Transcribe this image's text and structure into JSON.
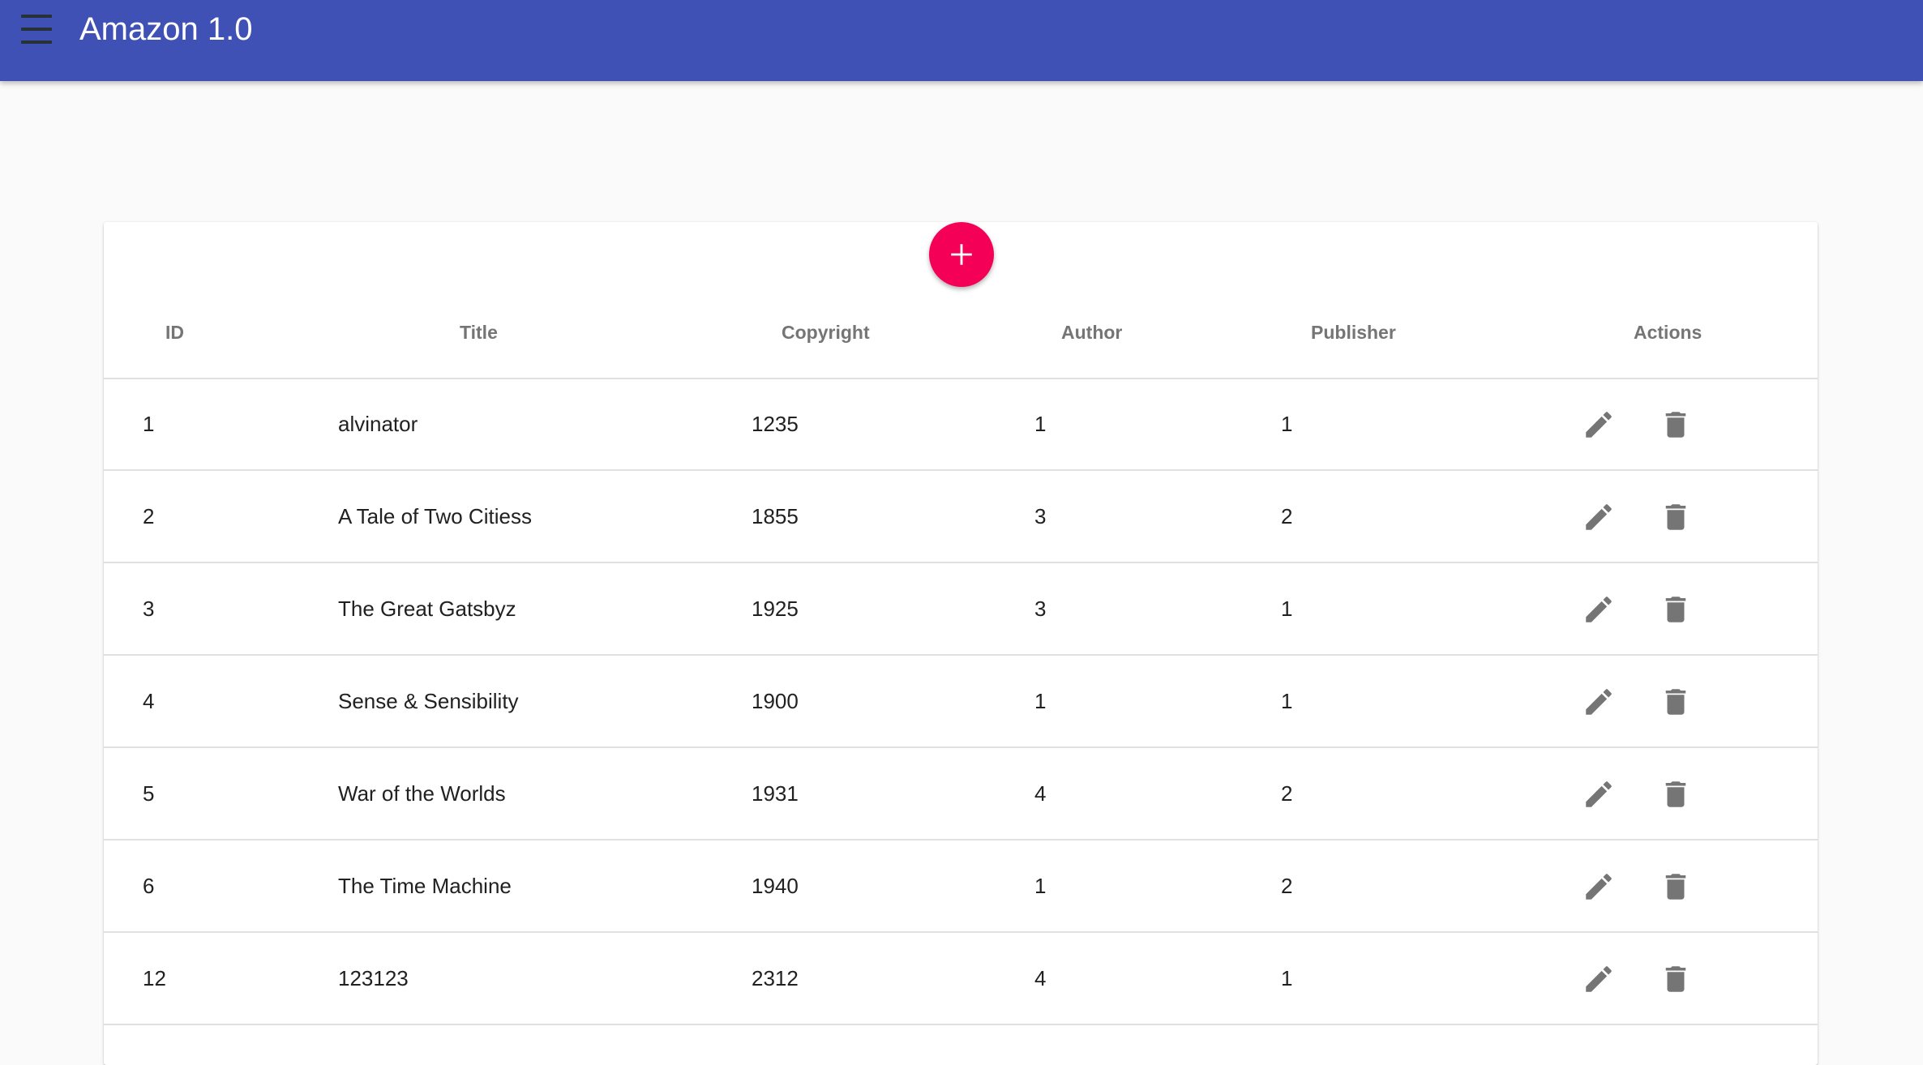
{
  "appbar": {
    "title": "Amazon 1.0",
    "menu_icon": "menu-icon",
    "color": "#3f51b5"
  },
  "fab": {
    "icon": "add-icon",
    "color": "#f50057"
  },
  "table": {
    "headers": {
      "id": "ID",
      "title": "Title",
      "copyright": "Copyright",
      "author": "Author",
      "publisher": "Publisher",
      "actions": "Actions"
    },
    "rows": [
      {
        "id": "1",
        "title": "alvinator",
        "copyright": "1235",
        "author": "1",
        "publisher": "1"
      },
      {
        "id": "2",
        "title": "A Tale of Two Citiess",
        "copyright": "1855",
        "author": "3",
        "publisher": "2"
      },
      {
        "id": "3",
        "title": "The Great Gatsbyz",
        "copyright": "1925",
        "author": "3",
        "publisher": "1"
      },
      {
        "id": "4",
        "title": "Sense & Sensibility",
        "copyright": "1900",
        "author": "1",
        "publisher": "1"
      },
      {
        "id": "5",
        "title": "War of the Worlds",
        "copyright": "1931",
        "author": "4",
        "publisher": "2"
      },
      {
        "id": "6",
        "title": "The Time Machine",
        "copyright": "1940",
        "author": "1",
        "publisher": "2"
      },
      {
        "id": "12",
        "title": "123123",
        "copyright": "2312",
        "author": "4",
        "publisher": "1"
      }
    ],
    "row_action_icons": [
      "edit-icon",
      "delete-icon"
    ],
    "icon_color": "#757575"
  }
}
